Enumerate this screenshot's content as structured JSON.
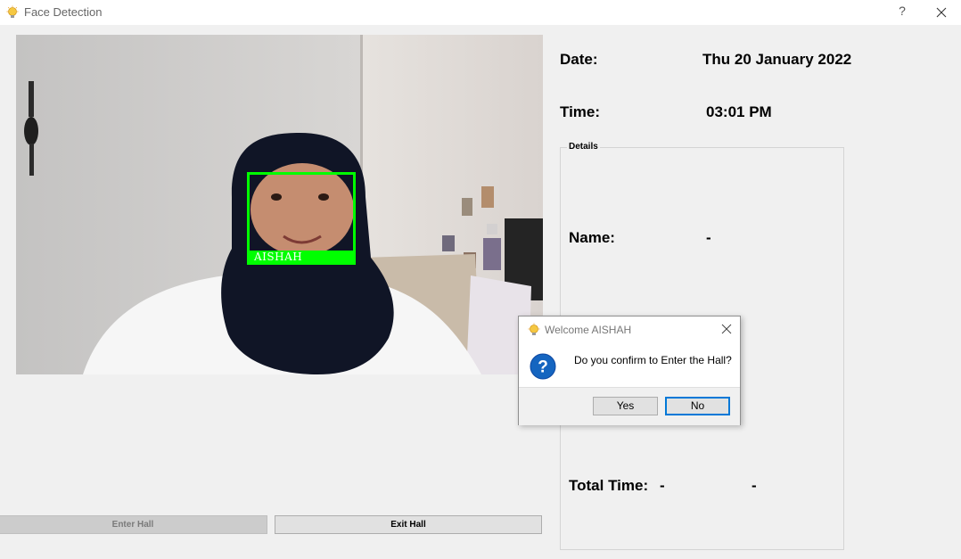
{
  "window": {
    "title": "Face Detection",
    "help_label": "?",
    "icon": "lightbulb-icon"
  },
  "camera": {
    "face_label": "AISHAH",
    "box_color": "#00ff00"
  },
  "info": {
    "date_label": "Date:",
    "date_value": "Thu 20 January 2022",
    "time_label": "Time:",
    "time_value": "03:01 PM"
  },
  "details": {
    "group_title": "Details",
    "name_label": "Name:",
    "name_value": "-",
    "total_time_label": "Total Time:",
    "total_time_value_1": "-",
    "total_time_value_2": "-"
  },
  "buttons": {
    "enter_hall": "Enter Hall",
    "exit_hall": "Exit Hall"
  },
  "dialog": {
    "title": "Welcome AISHAH",
    "message": "Do you confirm to Enter the Hall?",
    "yes": "Yes",
    "no": "No",
    "icon": "question-icon"
  },
  "colors": {
    "background": "#f0f0f0",
    "focus_blue": "#0078d7",
    "question_blue": "#1565c0"
  }
}
